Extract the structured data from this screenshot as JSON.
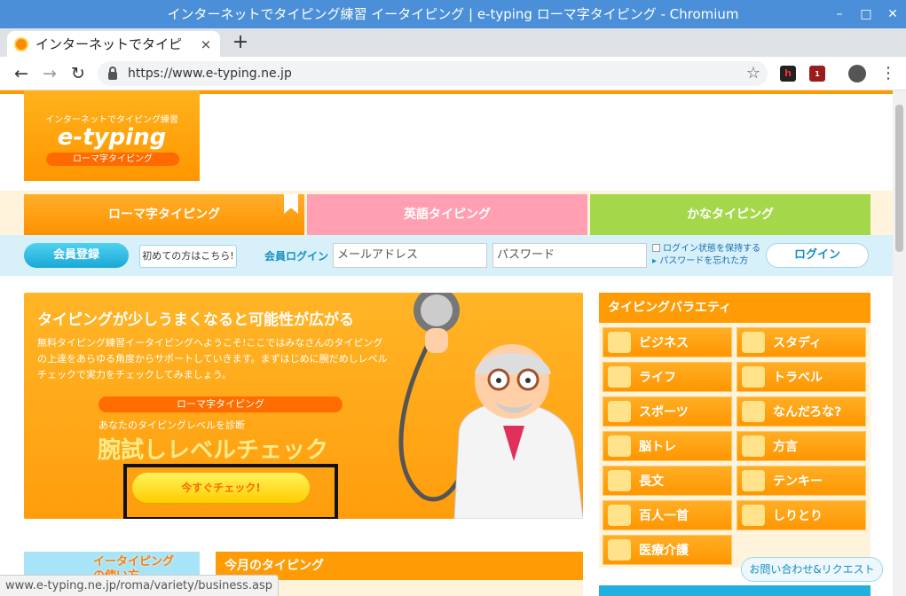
{
  "window": {
    "title": "インターネットでタイピング練習 イータイピング | e-typing ローマ字タイピング - Chromium"
  },
  "tab": {
    "title": "インターネットでタイピ",
    "close": "×",
    "newtab": "+"
  },
  "toolbar": {
    "url": "https://www.e-typing.ne.jp",
    "ext_badge": "1"
  },
  "logo": {
    "sub": "インターネットでタイピング練習",
    "main": "e-typing",
    "badge": "ローマ字タイピング"
  },
  "mode_tabs": [
    {
      "label": "ローマ字タイピング",
      "color": "#ff9c05"
    },
    {
      "label": "英語タイピング",
      "color": "#ff9fb1"
    },
    {
      "label": "かなタイピング",
      "color": "#a4d84a"
    }
  ],
  "login": {
    "register": "会員登録",
    "first_time": "初めての方はこちら!",
    "member_login": "会員ログイン",
    "email_placeholder": "メールアドレス",
    "password_placeholder": "パスワード",
    "keep_login": "ログイン状態を保持する",
    "forgot": "パスワードを忘れた方",
    "login_button": "ログイン"
  },
  "hero": {
    "title": "タイピングが少しうまくなると可能性が広がる",
    "desc": "無料タイピング練習イータイピングへようこそ!ここではみなさんのタイピングの上達をあらゆる角度からサポートしていきます。まずはじめに腕だめしレベルチェックで実力をチェックしてみましょう。",
    "pill": "ローマ字タイピング",
    "level": "あなたのタイピングレベルを診断",
    "check": "腕試しレベルチェック",
    "button": "今すぐチェック!"
  },
  "variety": {
    "title": "タイピングバラエティ",
    "items": [
      "ビジネス",
      "スタディ",
      "ライフ",
      "トラベル",
      "スポーツ",
      "なんだろな?",
      "脳トレ",
      "方言",
      "長文",
      "テンキー",
      "百人一首",
      "しりとり",
      "医療介護"
    ]
  },
  "howto": {
    "text1": "イータイピング",
    "text2": "の使い方"
  },
  "monthly": {
    "title": "今月のタイピング"
  },
  "contact": {
    "label": "お問い合わせ&リクエスト"
  },
  "status": {
    "url": "www.e-typing.ne.jp/roma/variety/business.asp"
  },
  "colors": {
    "titlebar": "#4a8fd8",
    "brand_orange": "#ff9c05",
    "login_band": "#d7f0fa"
  }
}
